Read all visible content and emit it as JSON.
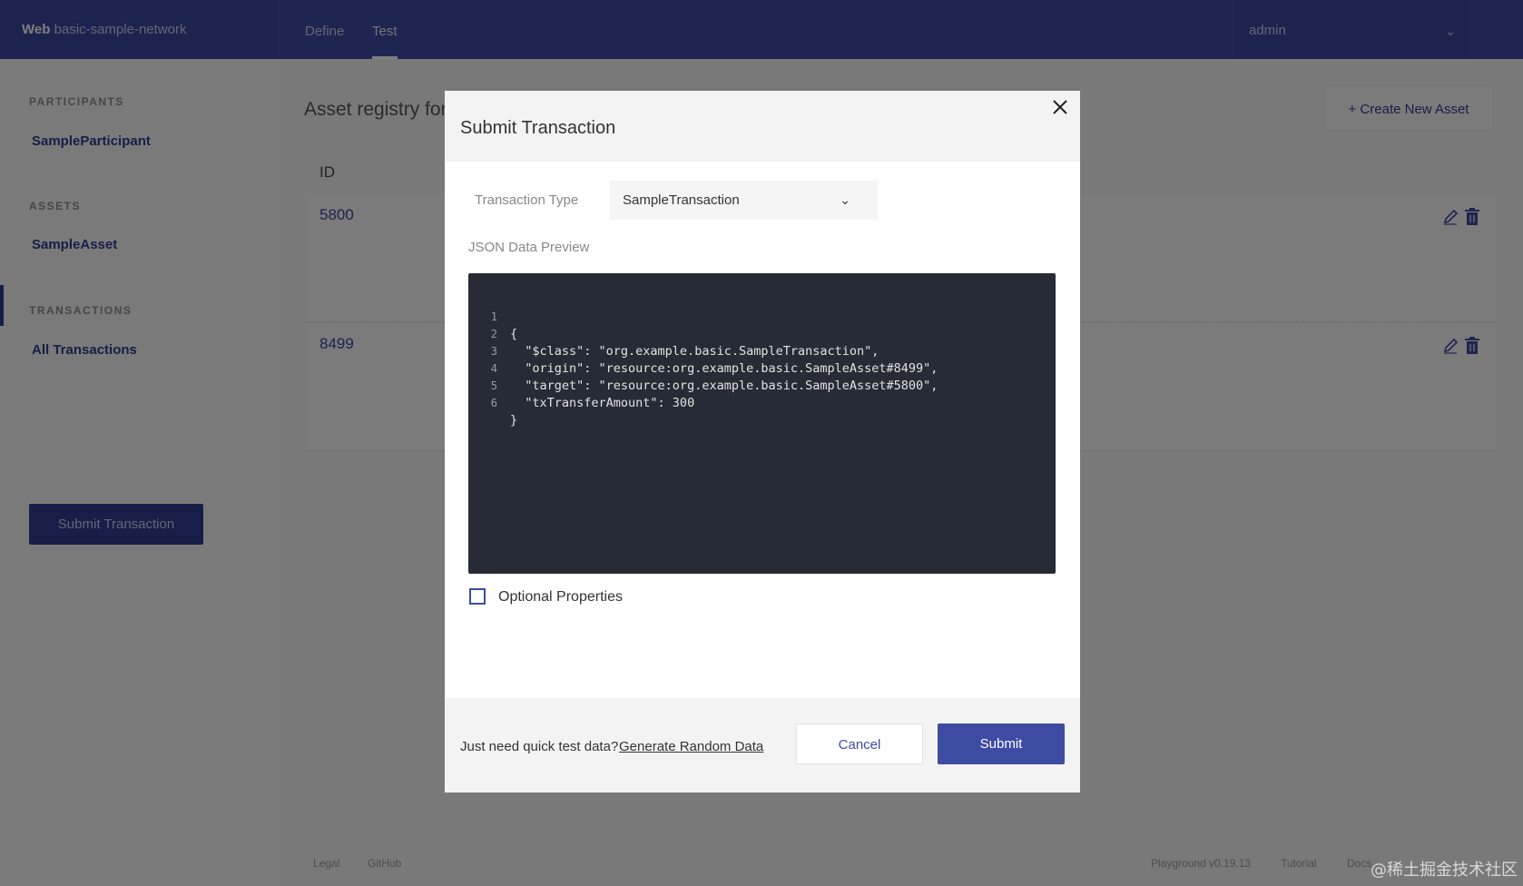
{
  "header": {
    "brand_bold": "Web",
    "brand_network": "basic-sample-network",
    "tabs": [
      {
        "label": "Define"
      },
      {
        "label": "Test"
      }
    ],
    "user": "admin"
  },
  "sidebar": {
    "participants_heading": "PARTICIPANTS",
    "participant_item": "SampleParticipant",
    "assets_heading": "ASSETS",
    "asset_item": "SampleAsset",
    "transactions_heading": "TRANSACTIONS",
    "transactions_item": "All Transactions",
    "submit_button": "Submit Transaction"
  },
  "main": {
    "title": "Asset registry for",
    "create_button": "+ Create New Asset",
    "id_header": "ID",
    "rows": [
      {
        "id": "5800"
      },
      {
        "id": "8499"
      }
    ]
  },
  "footer": {
    "legal": "Legal",
    "github": "GitHub",
    "version": "Playground v0.19.13",
    "tutorial": "Tutorial",
    "docs": "Docs"
  },
  "watermark": "@稀土掘金技术社区",
  "modal": {
    "title": "Submit Transaction",
    "transaction_type_label": "Transaction Type",
    "transaction_type_value": "SampleTransaction",
    "json_label": "JSON Data Preview",
    "code_lines": [
      {
        "n": "1",
        "text": "{"
      },
      {
        "n": "2",
        "text": "  \"$class\": \"org.example.basic.SampleTransaction\","
      },
      {
        "n": "3",
        "text": "  \"origin\": \"resource:org.example.basic.SampleAsset#8499\","
      },
      {
        "n": "4",
        "text": "  \"target\": \"resource:org.example.basic.SampleAsset#5800\","
      },
      {
        "n": "5",
        "text": "  \"txTransferAmount\": 300"
      },
      {
        "n": "6",
        "text": "}"
      }
    ],
    "optional_label": "Optional Properties",
    "quick_text": "Just need quick test data?",
    "generate_link": "Generate Random Data",
    "cancel_label": "Cancel",
    "submit_label": "Submit"
  },
  "colors": {
    "primary": "#3d4ba3",
    "code_bg": "#262b36"
  }
}
